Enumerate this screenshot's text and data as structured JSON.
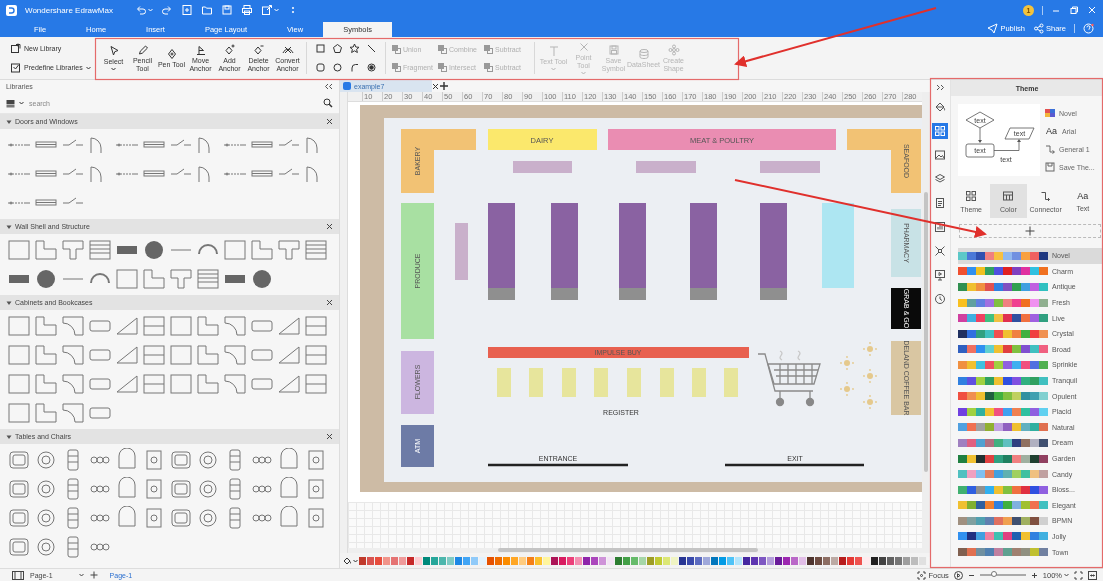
{
  "window": {
    "title": "Wondershare EdrawMax"
  },
  "account": {
    "badge": "1"
  },
  "menu_tabs": [
    {
      "label": "File",
      "selected": false
    },
    {
      "label": "Home",
      "selected": false
    },
    {
      "label": "Insert",
      "selected": false
    },
    {
      "label": "Page Layout",
      "selected": false
    },
    {
      "label": "View",
      "selected": false
    },
    {
      "label": "Symbols",
      "selected": true
    }
  ],
  "header_actions": [
    {
      "kind": "publish",
      "label": "Publish"
    },
    {
      "kind": "share",
      "label": "Share"
    }
  ],
  "ribbon": {
    "library_buttons": [
      {
        "kind": "new",
        "label": "New Library",
        "has_menu": false
      },
      {
        "kind": "predefine",
        "label": "Predefine Libraries",
        "has_menu": true
      }
    ],
    "tools": [
      {
        "kind": "select",
        "label": "Select",
        "has_menu": true,
        "disabled": false
      },
      {
        "kind": "pencil",
        "label": "Pencil Tool",
        "has_menu": false,
        "disabled": false
      },
      {
        "kind": "pen",
        "label": "Pen Tool",
        "has_menu": false,
        "disabled": false
      },
      {
        "kind": "move_anchor",
        "label": "Move Anchor",
        "has_menu": false,
        "disabled": false
      },
      {
        "kind": "add_anchor",
        "label": "Add Anchor",
        "has_menu": false,
        "disabled": false
      },
      {
        "kind": "delete_anchor",
        "label": "Delete Anchor",
        "has_menu": false,
        "disabled": false
      },
      {
        "kind": "convert_anchor",
        "label": "Convert Anchor",
        "has_menu": false,
        "disabled": false
      }
    ],
    "boolean_ops": [
      {
        "label": "Union",
        "disabled": true
      },
      {
        "label": "Combine",
        "disabled": true
      },
      {
        "label": "Subtract",
        "disabled": true
      },
      {
        "label": "Fragment",
        "disabled": true
      },
      {
        "label": "Intersect",
        "disabled": true
      },
      {
        "label": "Subtract",
        "disabled": true
      }
    ],
    "symbol_tools": [
      {
        "kind": "text",
        "label": "Text Tool",
        "has_menu": true,
        "disabled": true
      },
      {
        "kind": "point",
        "label": "Point Tool",
        "has_menu": true,
        "disabled": true
      },
      {
        "kind": "save_symbol",
        "label": "Save Symbol",
        "has_menu": false,
        "disabled": true
      },
      {
        "kind": "datasheet",
        "label": "DataSheet",
        "has_menu": false,
        "disabled": true
      },
      {
        "kind": "create_shape",
        "label": "Create Shape",
        "has_menu": false,
        "disabled": true
      }
    ]
  },
  "libraries": {
    "title": "Libraries",
    "search_placeholder": "search",
    "sections": [
      {
        "title": "Doors and Windows",
        "expanded": true
      },
      {
        "title": "Wall Shell and Structure",
        "expanded": true
      },
      {
        "title": "Cabinets and Bookcases",
        "expanded": true
      },
      {
        "title": "Tables and Chairs",
        "expanded": true
      }
    ]
  },
  "document_tabs": [
    {
      "label": "example7",
      "selected": true
    }
  ],
  "ruler_marks": [
    "10",
    "20",
    "30",
    "40",
    "50",
    "60",
    "70",
    "80",
    "90",
    "100",
    "110",
    "120",
    "130",
    "140",
    "150",
    "160",
    "170",
    "180",
    "190",
    "200",
    "210",
    "220",
    "230",
    "240",
    "250",
    "260",
    "270",
    "280"
  ],
  "floor_plan": {
    "zones": [
      {
        "label": "BAKERY",
        "color": "#f2c274"
      },
      {
        "label": "DAIRY",
        "color": "#fbe86c"
      },
      {
        "label": "MEAT & POULTRY",
        "color": "#ea8db2"
      },
      {
        "label": "SEAFOOD",
        "color": "#f2c274"
      },
      {
        "label": "PRODUCE",
        "color": "#a8e0a2"
      },
      {
        "label": "PHARMACY",
        "color": "#c8e2e6"
      },
      {
        "label": "GRAB & GO",
        "color": "#0a0a0a"
      },
      {
        "label": "DELAND COFFEE BAR",
        "color": "#d9c6a2"
      },
      {
        "label": "FLOWERS",
        "color": "#ccb6e0"
      },
      {
        "label": "ATM",
        "color": "#6d7ba6"
      },
      {
        "label": "IMPULSE BUY",
        "color": "#e8604f"
      }
    ],
    "fixtures": [
      {
        "kind": "display",
        "color": "#c9b0cb"
      },
      {
        "kind": "display",
        "color": "#c9b0cb"
      },
      {
        "kind": "display",
        "color": "#c9b0cb"
      },
      {
        "kind": "display",
        "color": "#c9b0cb"
      },
      {
        "kind": "shelf",
        "color": "#8a62a2"
      },
      {
        "kind": "shelf",
        "color": "#8a62a2"
      },
      {
        "kind": "shelf",
        "color": "#8a62a2"
      },
      {
        "kind": "shelf",
        "color": "#8a62a2"
      },
      {
        "kind": "shelf",
        "color": "#8a62a2"
      },
      {
        "kind": "cooler",
        "color": "#ade6f2"
      },
      {
        "kind": "register",
        "color": "#e7e59c"
      },
      {
        "kind": "register",
        "color": "#e7e59c"
      },
      {
        "kind": "register",
        "color": "#e7e59c"
      },
      {
        "kind": "register",
        "color": "#e7e59c"
      },
      {
        "kind": "register",
        "color": "#e7e59c"
      },
      {
        "kind": "register",
        "color": "#e7e59c"
      },
      {
        "kind": "register",
        "color": "#e7e59c"
      },
      {
        "kind": "register",
        "color": "#e7e59c"
      }
    ],
    "labels": [
      {
        "kind": "area",
        "text": "REGISTER"
      },
      {
        "kind": "doorway",
        "text": "ENTRANCE"
      },
      {
        "kind": "doorway",
        "text": "EXIT"
      }
    ]
  },
  "color_palette": [
    {
      "color": "#c0392b"
    },
    {
      "color": "#d9534f"
    },
    {
      "color": "#e74c3c"
    },
    {
      "color": "#f1948a"
    },
    {
      "color": "#e57373"
    },
    {
      "color": "#ef9a9a"
    },
    {
      "color": "#c62828"
    },
    {
      "color": "#ffcdd2"
    },
    {
      "color": "#00897b"
    },
    {
      "color": "#26a69a"
    },
    {
      "color": "#4db6ac"
    },
    {
      "color": "#80cbc4"
    },
    {
      "color": "#1e88e5"
    },
    {
      "color": "#42a5f5"
    },
    {
      "color": "#90caf9"
    },
    {
      "color": "#e3f2fd"
    },
    {
      "color": "#e65100"
    },
    {
      "color": "#ef6c00"
    },
    {
      "color": "#fb8c00"
    },
    {
      "color": "#ffa726"
    },
    {
      "color": "#ffcc80"
    },
    {
      "color": "#f57f17"
    },
    {
      "color": "#fbc02d"
    },
    {
      "color": "#fff59d"
    },
    {
      "color": "#ad1457"
    },
    {
      "color": "#d81b60"
    },
    {
      "color": "#ec407a"
    },
    {
      "color": "#f48fb1"
    },
    {
      "color": "#8e24aa"
    },
    {
      "color": "#ab47bc"
    },
    {
      "color": "#ce93d8"
    },
    {
      "color": "#f3e5f5"
    },
    {
      "color": "#2e7d32"
    },
    {
      "color": "#43a047"
    },
    {
      "color": "#66bb6a"
    },
    {
      "color": "#a5d6a7"
    },
    {
      "color": "#9e9d24"
    },
    {
      "color": "#c0ca33"
    },
    {
      "color": "#dce775"
    },
    {
      "color": "#f0f4c3"
    },
    {
      "color": "#283593"
    },
    {
      "color": "#3949ab"
    },
    {
      "color": "#5c6bc0"
    },
    {
      "color": "#9fa8da"
    },
    {
      "color": "#0277bd"
    },
    {
      "color": "#039be5"
    },
    {
      "color": "#4fc3f7"
    },
    {
      "color": "#b3e5fc"
    },
    {
      "color": "#4527a0"
    },
    {
      "color": "#5e35b1"
    },
    {
      "color": "#7e57c2"
    },
    {
      "color": "#b39ddb"
    },
    {
      "color": "#6a1b9a"
    },
    {
      "color": "#9c27b0"
    },
    {
      "color": "#ba68c8"
    },
    {
      "color": "#e1bee7"
    },
    {
      "color": "#4e342e"
    },
    {
      "color": "#6d4c41"
    },
    {
      "color": "#8d6e63"
    },
    {
      "color": "#bcaaa4"
    },
    {
      "color": "#b71c1c"
    },
    {
      "color": "#e53935"
    },
    {
      "color": "#ef5350"
    },
    {
      "color": "#ffebee"
    },
    {
      "color": "#212121"
    },
    {
      "color": "#424242"
    },
    {
      "color": "#616161"
    },
    {
      "color": "#757575"
    },
    {
      "color": "#9e9e9e"
    },
    {
      "color": "#bdbdbd"
    },
    {
      "color": "#e0e0e0"
    },
    {
      "color": "#f5f5f5"
    }
  ],
  "sidebar_tools": [
    {
      "kind": "fill",
      "selected": false
    },
    {
      "kind": "theme",
      "selected": true
    },
    {
      "kind": "image",
      "selected": false
    },
    {
      "kind": "layers",
      "selected": false
    },
    {
      "kind": "page",
      "selected": false
    },
    {
      "kind": "data",
      "selected": false
    },
    {
      "kind": "fit",
      "selected": false
    },
    {
      "kind": "presentation",
      "selected": false
    },
    {
      "kind": "history",
      "selected": false
    }
  ],
  "theme_panel": {
    "title": "Theme",
    "preview_labels": [
      "text",
      "text",
      "text",
      "text"
    ],
    "current": [
      {
        "kind": "theme",
        "label": "Novel"
      },
      {
        "kind": "font",
        "icon_text": "Aa",
        "label": "Arial"
      },
      {
        "kind": "connector",
        "label": "General 1"
      },
      {
        "kind": "save",
        "label": "Save The..."
      }
    ],
    "tabs": [
      {
        "kind": "theme",
        "label": "Theme",
        "selected": false
      },
      {
        "kind": "color",
        "label": "Color",
        "selected": true
      },
      {
        "kind": "connector",
        "label": "Connector",
        "selected": false
      },
      {
        "kind": "text",
        "icon_text": "Aa",
        "label": "Text",
        "selected": false
      }
    ],
    "color_themes": [
      {
        "name": "Novel",
        "selected": true,
        "colors": [
          {
            "color": "#5cc8c8"
          },
          {
            "color": "#4a78d8"
          },
          {
            "color": "#3050b0"
          },
          {
            "color": "#f08080"
          },
          {
            "color": "#f8c040"
          },
          {
            "color": "#90b8f0"
          },
          {
            "color": "#7090e0"
          },
          {
            "color": "#f8a040"
          },
          {
            "color": "#f06060"
          },
          {
            "color": "#203880"
          }
        ]
      },
      {
        "name": "Charm",
        "selected": false,
        "colors": [
          {
            "color": "#f05030"
          },
          {
            "color": "#3090f0"
          },
          {
            "color": "#f0c020"
          },
          {
            "color": "#30a060"
          },
          {
            "color": "#5050e0"
          },
          {
            "color": "#e02020"
          },
          {
            "color": "#8040c0"
          },
          {
            "color": "#e030a0"
          },
          {
            "color": "#30c0e0"
          },
          {
            "color": "#f07020"
          }
        ]
      },
      {
        "name": "Antique",
        "selected": false,
        "colors": [
          {
            "color": "#309050"
          },
          {
            "color": "#f0c030"
          },
          {
            "color": "#f09040"
          },
          {
            "color": "#e05050"
          },
          {
            "color": "#3080e0"
          },
          {
            "color": "#8050c0"
          },
          {
            "color": "#30a050"
          },
          {
            "color": "#40a0e0"
          },
          {
            "color": "#c060e0"
          },
          {
            "color": "#30c0c0"
          }
        ]
      },
      {
        "name": "Fresh",
        "selected": false,
        "colors": [
          {
            "color": "#f8c020"
          },
          {
            "color": "#60a0a0"
          },
          {
            "color": "#6080e0"
          },
          {
            "color": "#a070e0"
          },
          {
            "color": "#80c040"
          },
          {
            "color": "#f08080"
          },
          {
            "color": "#f04090"
          },
          {
            "color": "#f07020"
          },
          {
            "color": "#f090f0"
          },
          {
            "color": "#90b090"
          }
        ]
      },
      {
        "name": "Live",
        "selected": false,
        "colors": [
          {
            "color": "#d040a0"
          },
          {
            "color": "#40b0e0"
          },
          {
            "color": "#f04060"
          },
          {
            "color": "#40c080"
          },
          {
            "color": "#f0c040"
          },
          {
            "color": "#e03050"
          },
          {
            "color": "#3050a0"
          },
          {
            "color": "#f07040"
          },
          {
            "color": "#a060e0"
          },
          {
            "color": "#30a080"
          }
        ]
      },
      {
        "name": "Crystal",
        "selected": false,
        "colors": [
          {
            "color": "#203060"
          },
          {
            "color": "#3070e0"
          },
          {
            "color": "#30a080"
          },
          {
            "color": "#40c0c0"
          },
          {
            "color": "#f05050"
          },
          {
            "color": "#f0c030"
          },
          {
            "color": "#f08040"
          },
          {
            "color": "#40b040"
          },
          {
            "color": "#f04040"
          },
          {
            "color": "#f09050"
          }
        ]
      },
      {
        "name": "Broad",
        "selected": false,
        "colors": [
          {
            "color": "#3060c0"
          },
          {
            "color": "#f07060"
          },
          {
            "color": "#3090f0"
          },
          {
            "color": "#60d0d0"
          },
          {
            "color": "#f0c030"
          },
          {
            "color": "#e04040"
          },
          {
            "color": "#80c040"
          },
          {
            "color": "#8050d0"
          },
          {
            "color": "#40c0c0"
          },
          {
            "color": "#f06080"
          }
        ]
      },
      {
        "name": "Sprinkle",
        "selected": false,
        "colors": [
          {
            "color": "#f09040"
          },
          {
            "color": "#f0c030"
          },
          {
            "color": "#40c0e0"
          },
          {
            "color": "#f05060"
          },
          {
            "color": "#a0d040"
          },
          {
            "color": "#9060e0"
          },
          {
            "color": "#40b0f0"
          },
          {
            "color": "#f05080"
          },
          {
            "color": "#5070e0"
          },
          {
            "color": "#50b050"
          }
        ]
      },
      {
        "name": "Tranquil",
        "selected": false,
        "colors": [
          {
            "color": "#3080e0"
          },
          {
            "color": "#6050e0"
          },
          {
            "color": "#a0d040"
          },
          {
            "color": "#30a060"
          },
          {
            "color": "#f0c030"
          },
          {
            "color": "#3050e0"
          },
          {
            "color": "#8050e0"
          },
          {
            "color": "#30b080"
          },
          {
            "color": "#30a060"
          },
          {
            "color": "#40c0c0"
          }
        ]
      },
      {
        "name": "Opulent",
        "selected": false,
        "colors": [
          {
            "color": "#f05040"
          },
          {
            "color": "#f09050"
          },
          {
            "color": "#f0c030"
          },
          {
            "color": "#206040"
          },
          {
            "color": "#40b040"
          },
          {
            "color": "#80c040"
          },
          {
            "color": "#c0d060"
          },
          {
            "color": "#3090a0"
          },
          {
            "color": "#40a0b0"
          },
          {
            "color": "#80d0d0"
          }
        ]
      },
      {
        "name": "Placid",
        "selected": false,
        "colors": [
          {
            "color": "#7040e0"
          },
          {
            "color": "#a0d040"
          },
          {
            "color": "#30b0a0"
          },
          {
            "color": "#f0c030"
          },
          {
            "color": "#f05080"
          },
          {
            "color": "#40a0f0"
          },
          {
            "color": "#f08050"
          },
          {
            "color": "#30c0a0"
          },
          {
            "color": "#9060e0"
          },
          {
            "color": "#60d0f0"
          }
        ]
      },
      {
        "name": "Natural",
        "selected": false,
        "colors": [
          {
            "color": "#50a0e0"
          },
          {
            "color": "#f07050"
          },
          {
            "color": "#a0a0a0"
          },
          {
            "color": "#90b030"
          },
          {
            "color": "#c0a0e0"
          },
          {
            "color": "#9060c0"
          },
          {
            "color": "#f0c030"
          },
          {
            "color": "#60b0c0"
          },
          {
            "color": "#30b0a0"
          },
          {
            "color": "#e07050"
          }
        ]
      },
      {
        "name": "Dream",
        "selected": false,
        "colors": [
          {
            "color": "#a080c0"
          },
          {
            "color": "#e06080"
          },
          {
            "color": "#50a0d0"
          },
          {
            "color": "#b07080"
          },
          {
            "color": "#40b080"
          },
          {
            "color": "#60c0c0"
          },
          {
            "color": "#304080"
          },
          {
            "color": "#907060"
          },
          {
            "color": "#b0b0c0"
          },
          {
            "color": "#405070"
          }
        ]
      },
      {
        "name": "Garden",
        "selected": false,
        "colors": [
          {
            "color": "#208040"
          },
          {
            "color": "#f0c030"
          },
          {
            "color": "#203030"
          },
          {
            "color": "#e04040"
          },
          {
            "color": "#30a080"
          },
          {
            "color": "#208060"
          },
          {
            "color": "#f08080"
          },
          {
            "color": "#a0b0a0"
          },
          {
            "color": "#204030"
          },
          {
            "color": "#904060"
          }
        ]
      },
      {
        "name": "Candy",
        "selected": false,
        "colors": [
          {
            "color": "#50c0c0"
          },
          {
            "color": "#f0a0c0"
          },
          {
            "color": "#80c0f0"
          },
          {
            "color": "#e08060"
          },
          {
            "color": "#40a0e0"
          },
          {
            "color": "#60b0b0"
          },
          {
            "color": "#a0d060"
          },
          {
            "color": "#40c0a0"
          },
          {
            "color": "#f0c080"
          },
          {
            "color": "#c0a0a0"
          }
        ]
      },
      {
        "name": "Bloss...",
        "selected": false,
        "colors": [
          {
            "color": "#40b070"
          },
          {
            "color": "#3060e0"
          },
          {
            "color": "#909090"
          },
          {
            "color": "#30b0f0"
          },
          {
            "color": "#f0c030"
          },
          {
            "color": "#80c040"
          },
          {
            "color": "#f07040"
          },
          {
            "color": "#e03040"
          },
          {
            "color": "#3050e0"
          },
          {
            "color": "#9060e0"
          }
        ]
      },
      {
        "name": "Elegant",
        "selected": false,
        "colors": [
          {
            "color": "#f0c030"
          },
          {
            "color": "#80b030"
          },
          {
            "color": "#3060a0"
          },
          {
            "color": "#f08030"
          },
          {
            "color": "#3080e0"
          },
          {
            "color": "#40b040"
          },
          {
            "color": "#80b0e0"
          },
          {
            "color": "#a0c030"
          },
          {
            "color": "#f07050"
          },
          {
            "color": "#40c0c0"
          }
        ]
      },
      {
        "name": "BPMN",
        "selected": false,
        "colors": [
          {
            "color": "#a09080"
          },
          {
            "color": "#80a0a0"
          },
          {
            "color": "#50a0b0"
          },
          {
            "color": "#6080b0"
          },
          {
            "color": "#e07060"
          },
          {
            "color": "#f0a050"
          },
          {
            "color": "#405070"
          },
          {
            "color": "#a0b060"
          },
          {
            "color": "#805040"
          },
          {
            "color": "#d0d0d0"
          }
        ]
      },
      {
        "name": "Jolly",
        "selected": false,
        "colors": [
          {
            "color": "#3090f0"
          },
          {
            "color": "#203080"
          },
          {
            "color": "#40a0e0"
          },
          {
            "color": "#f080a0"
          },
          {
            "color": "#40c0b0"
          },
          {
            "color": "#e04080"
          },
          {
            "color": "#2060b0"
          },
          {
            "color": "#f0c030"
          },
          {
            "color": "#3080e0"
          },
          {
            "color": "#40b0e0"
          }
        ]
      },
      {
        "name": "Town",
        "selected": false,
        "colors": [
          {
            "color": "#806050"
          },
          {
            "color": "#e07050"
          },
          {
            "color": "#7090a0"
          },
          {
            "color": "#5080b0"
          },
          {
            "color": "#c080a0"
          },
          {
            "color": "#60a090"
          },
          {
            "color": "#a08070"
          },
          {
            "color": "#909080"
          },
          {
            "color": "#c0c030"
          },
          {
            "color": "#7080a0"
          }
        ]
      }
    ]
  },
  "status_bar": {
    "page_selector": "Page-1",
    "pages": [
      {
        "label": "Page-1",
        "selected": true
      }
    ],
    "focus": "Focus",
    "zoom": {
      "level": 0.3,
      "reading": "100%"
    }
  }
}
